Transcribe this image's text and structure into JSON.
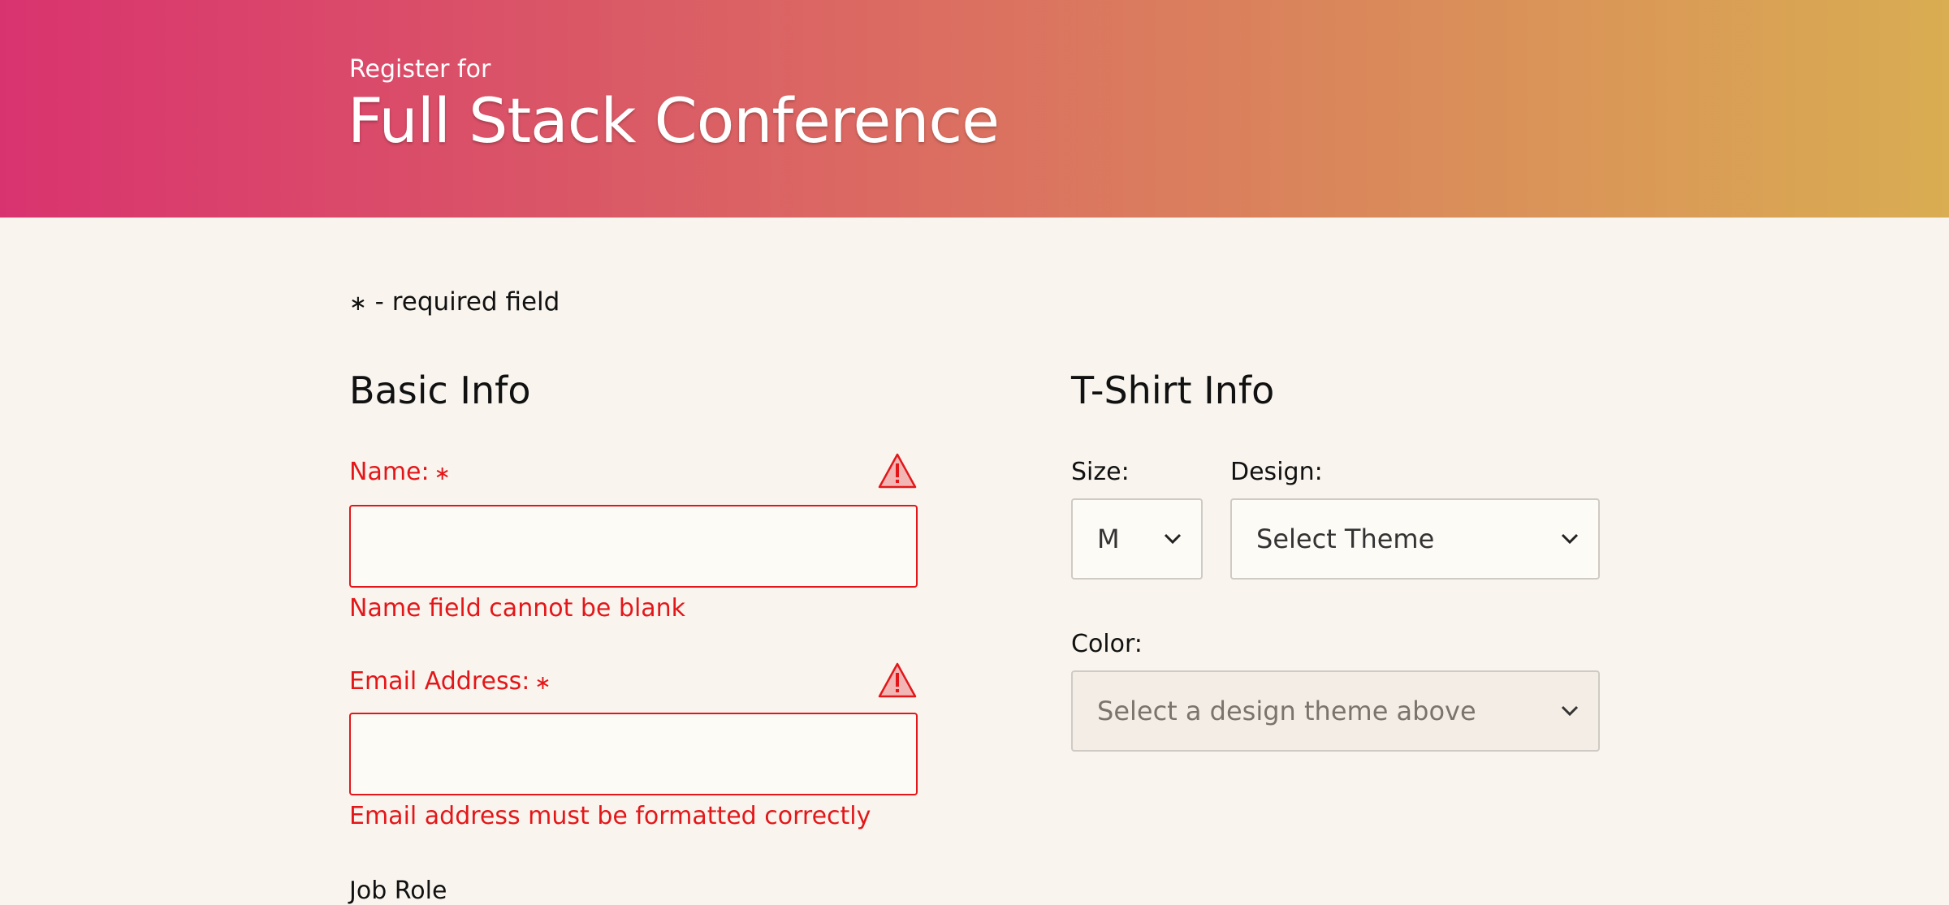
{
  "header": {
    "pretitle": "Register for",
    "title": "Full Stack Conference"
  },
  "required_note": {
    "asterisk": "∗",
    "text": "- required field"
  },
  "basic_info": {
    "heading": "Basic Info",
    "name": {
      "label": "Name:",
      "required_mark": "∗",
      "value": "",
      "error": "Name field cannot be blank"
    },
    "email": {
      "label": "Email Address:",
      "required_mark": "∗",
      "value": "",
      "error": "Email address must be formatted correctly"
    },
    "job_role_label": "Job Role"
  },
  "tshirt_info": {
    "heading": "T-Shirt Info",
    "size": {
      "label": "Size:",
      "selected": "M"
    },
    "design": {
      "label": "Design:",
      "selected": "Select Theme"
    },
    "color": {
      "label": "Color:",
      "selected": "Select a design theme above",
      "disabled": true
    }
  },
  "colors": {
    "error": "#e3171a",
    "background": "#f9f5ee",
    "header_gradient_start": "#d9336f",
    "header_gradient_end": "#d9ad52"
  },
  "icons": [
    "warning-icon",
    "chevron-down-icon"
  ]
}
